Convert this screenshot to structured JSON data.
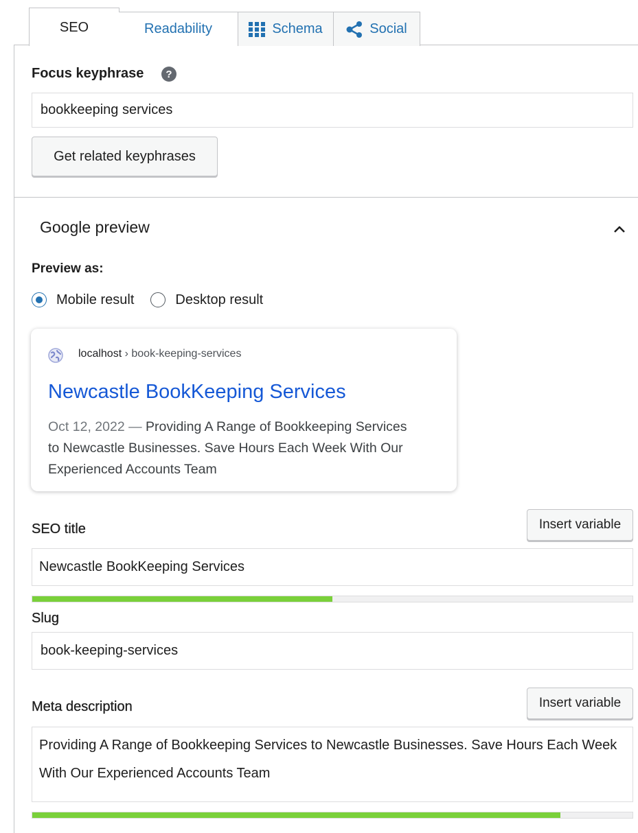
{
  "tabs": [
    {
      "label": "SEO",
      "active": true
    },
    {
      "label": "Readability",
      "active": false
    },
    {
      "label": "Schema",
      "active": false,
      "icon": "grid-icon"
    },
    {
      "label": "Social",
      "active": false,
      "icon": "share-icon"
    }
  ],
  "focus_keyphrase": {
    "label": "Focus keyphrase",
    "help_icon": "?",
    "value": "bookkeeping services",
    "related_button": "Get related keyphrases"
  },
  "google_preview": {
    "title": "Google preview",
    "preview_as_label": "Preview as:",
    "options": [
      {
        "label": "Mobile result",
        "checked": true
      },
      {
        "label": "Desktop result",
        "checked": false
      }
    ],
    "result": {
      "host": "localhost",
      "separator": " › ",
      "path": "book-keeping-services",
      "title": "Newcastle BookKeeping Services",
      "date": "Oct 12, 2022",
      "dash": " — ",
      "description": "Providing A Range of Bookkeeping Services to Newcastle Businesses. Save Hours Each Week With Our Experienced Accounts Team"
    }
  },
  "seo_title": {
    "label": "SEO title",
    "insert_button": "Insert variable",
    "value": "Newcastle BookKeeping Services",
    "progress_percent": 50
  },
  "slug": {
    "label": "Slug",
    "value": "book-keeping-services"
  },
  "meta_description": {
    "label": "Meta description",
    "insert_button": "Insert variable",
    "value": "Providing A Range of Bookkeeping Services to Newcastle Businesses. Save Hours Each Week With Our Experienced Accounts Team",
    "progress_percent": 88
  },
  "colors": {
    "link_blue": "#2271b1",
    "result_title_blue": "#1558d6",
    "progress_green": "#7ad03a",
    "border": "#c3c4c7"
  }
}
